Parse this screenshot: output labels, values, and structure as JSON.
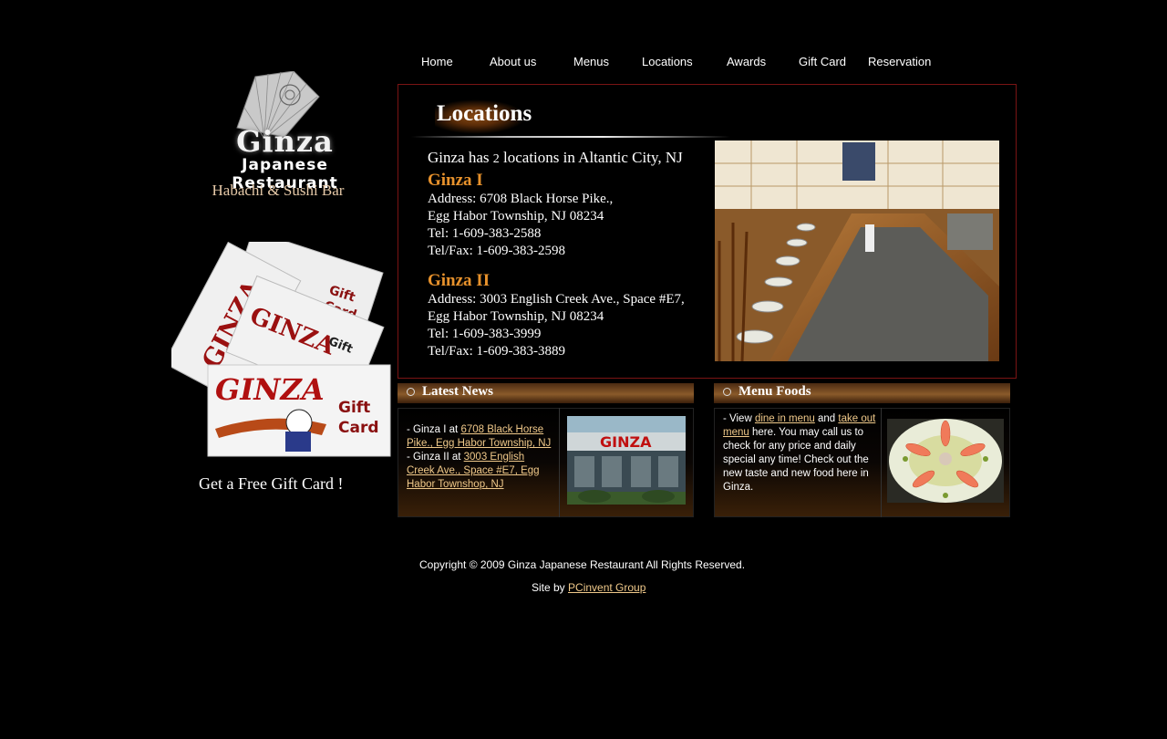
{
  "nav": {
    "items": [
      "Home",
      "About us",
      "Menus",
      "Locations",
      "Awards",
      "Gift Card",
      "Reservation"
    ]
  },
  "logo": {
    "brand": "Ginza",
    "subtitle": "Japanese Restaurant",
    "tagline": "Habachi & Sushi Bar"
  },
  "gift_card": {
    "caption": "Get a Free Gift Card !",
    "card_brand": "GINZA",
    "card_label_1": "Gift",
    "card_label_2": "Card"
  },
  "locations": {
    "title": "Locations",
    "intro_pre": "Ginza has ",
    "intro_num": "2",
    "intro_post": " locations in Altantic City, NJ",
    "loc1": {
      "name": "Ginza I",
      "address1": "Address: 6708 Black Horse Pike.,",
      "address2": "Egg Habor Township, NJ 08234",
      "tel": "Tel: 1-609-383-2588",
      "fax": "Tel/Fax: 1-609-383-2598"
    },
    "loc2": {
      "name": "Ginza II",
      "address1": "Address: 3003 English Creek Ave., Space #E7,",
      "address2": "Egg Habor Township, NJ 08234",
      "tel": "Tel: 1-609-383-3999",
      "fax": "Tel/Fax: 1-609-383-3889"
    }
  },
  "news": {
    "title": "Latest News",
    "line1_pre": "- Ginza I at ",
    "line1_link": "6708 Black Horse Pike., Egg Habor Township, NJ",
    "line2_pre": "- Ginza II at ",
    "line2_link": "3003 English Creek Ave., Space #E7, Egg Habor Townshop, NJ",
    "storefront_sign": "GINZA"
  },
  "foods": {
    "title": "Menu Foods",
    "pre": "- View ",
    "link1": "dine in menu",
    "mid": " and ",
    "link2": "take out menu",
    "post": " here. You may call us to check for any price and daily special any time! Check out the new taste and new food here in Ginza."
  },
  "footer": {
    "copyright": "Copyright © 2009 Ginza Japanese Restaurant  All Rights Reserved.",
    "site_by": "Site by ",
    "site_by_link": "PCinvent Group"
  },
  "colors": {
    "accent_orange": "#e8922c",
    "link": "#f0c98a",
    "panel_border": "#7a1414"
  }
}
